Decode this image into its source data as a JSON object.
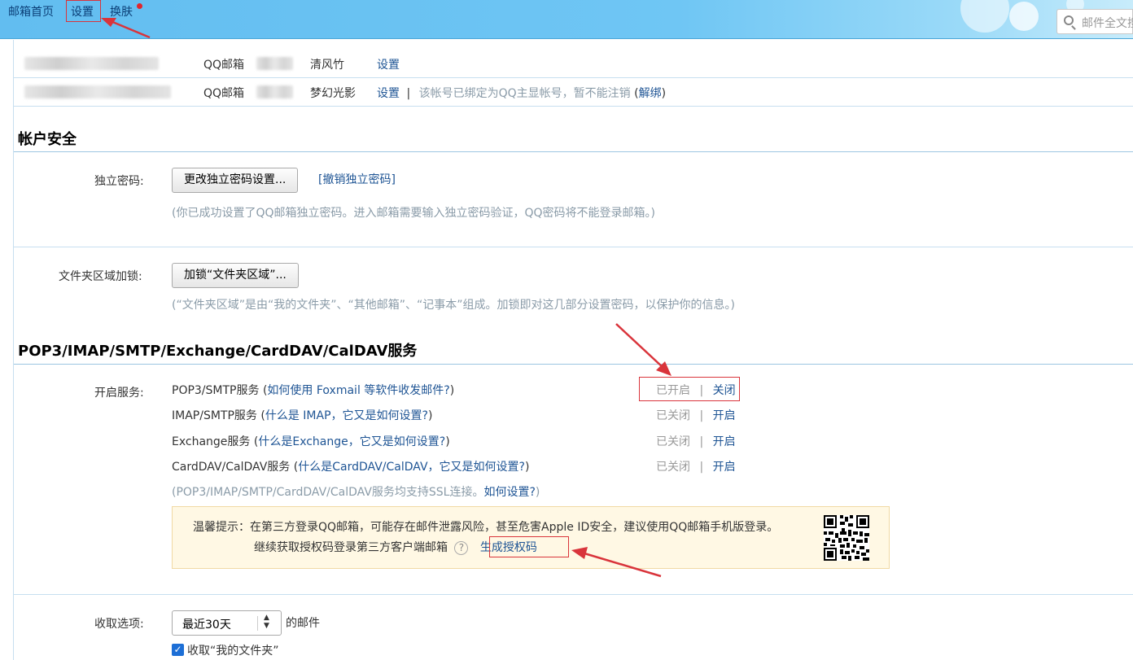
{
  "nav": {
    "home": "邮箱首页",
    "settings": "设置",
    "skin": "换肤"
  },
  "search": {
    "placeholder": "邮件全文搜"
  },
  "accounts": [
    {
      "type": "QQ邮箱",
      "nickname": "清风竹",
      "settings_link": "设置"
    },
    {
      "type": "QQ邮箱",
      "nickname": "梦幻光影",
      "settings_link": "设置",
      "separator": "|",
      "note": "该帐号已绑定为QQ主显帐号，暂不能注销",
      "unbind_open": "(",
      "unbind_link": "解绑",
      "unbind_close": ")"
    }
  ],
  "security": {
    "title": "帐户安全",
    "password_label": "独立密码:",
    "password_button": "更改独立密码设置...",
    "revoke_link": "[撤销独立密码]",
    "password_note": "(你已成功设置了QQ邮箱独立密码。进入邮箱需要输入独立密码验证，QQ密码将不能登录邮箱。)",
    "folder_lock_label": "文件夹区域加锁:",
    "folder_lock_button": "加锁“文件夹区域”...",
    "folder_lock_note": "(“文件夹区域”是由“我的文件夹”、“其他邮箱”、“记事本”组成。加锁即对这几部分设置密码，以保护你的信息。)"
  },
  "services": {
    "title": "POP3/IMAP/SMTP/Exchange/CardDAV/CalDAV服务",
    "enable_label": "开启服务:",
    "items": [
      {
        "name": "POP3/SMTP服务",
        "paren_open": "(",
        "help": "如何使用 Foxmail 等软件收发邮件?",
        "paren_close": ")",
        "status": "已开启",
        "sep": "|",
        "action": "关闭"
      },
      {
        "name": "IMAP/SMTP服务",
        "paren_open": "(",
        "help": "什么是 IMAP，它又是如何设置?",
        "paren_close": ")",
        "status": "已关闭",
        "sep": "|",
        "action": "开启"
      },
      {
        "name": "Exchange服务",
        "paren_open": "(",
        "help": "什么是Exchange，它又是如何设置?",
        "paren_close": ")",
        "status": "已关闭",
        "sep": "|",
        "action": "开启"
      },
      {
        "name": "CardDAV/CalDAV服务",
        "paren_open": "(",
        "help": "什么是CardDAV/CalDAV，它又是如何设置?",
        "paren_close": ")",
        "status": "已关闭",
        "sep": "|",
        "action": "开启"
      }
    ],
    "ssl_note": "(POP3/IMAP/SMTP/CardDAV/CalDAV服务均支持SSL连接。",
    "ssl_link": "如何设置?",
    "ssl_close": ")",
    "tip_line1": "温馨提示：在第三方登录QQ邮箱，可能存在邮件泄露风险，甚至危害Apple ID安全，建议使用QQ邮箱手机版登录。",
    "tip_line2": "继续获取授权码登录第三方客户端邮箱",
    "help_mark": "?",
    "generate_button": "生成授权码"
  },
  "receive": {
    "label": "收取选项:",
    "select_value": "最近30天",
    "suffix": "的邮件",
    "checkbox_label": "收取“我的文件夹”"
  },
  "colors": {
    "annotation_red": "#d9343b",
    "link": "#1e5494",
    "tip_bg": "#fff8e4"
  }
}
